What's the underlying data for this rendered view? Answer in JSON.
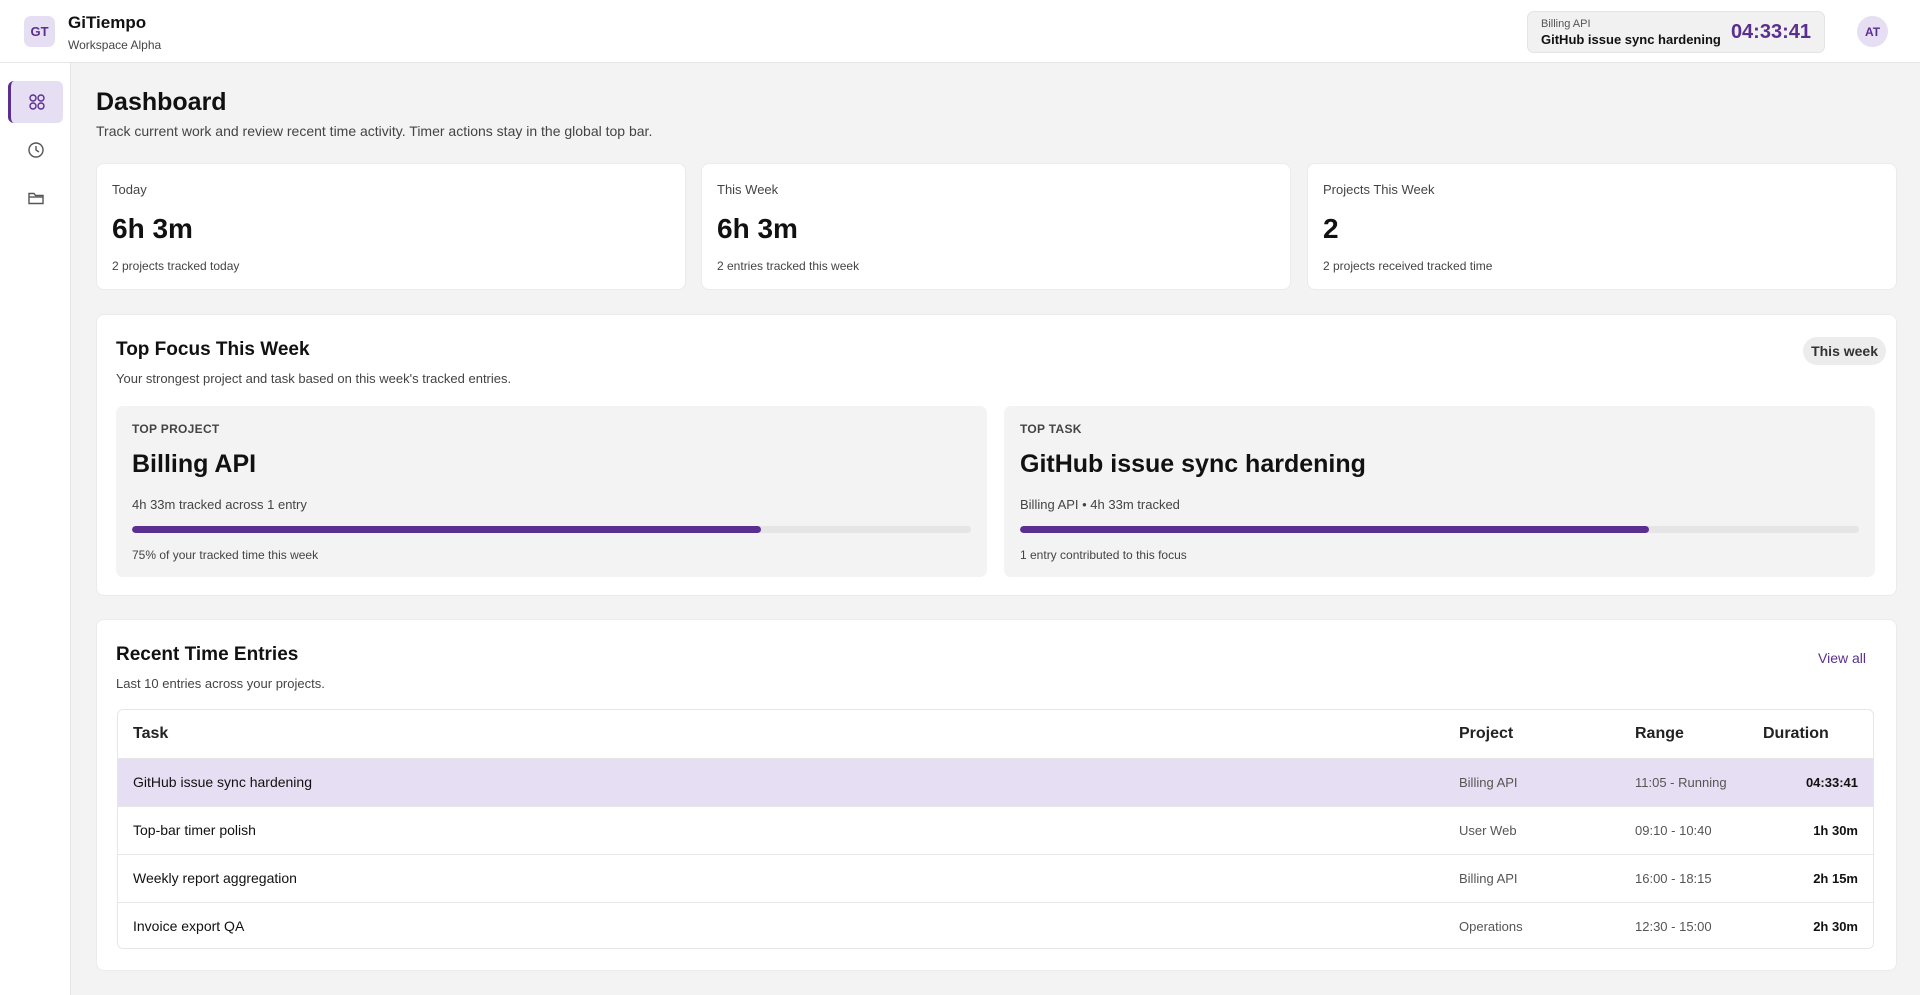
{
  "app": {
    "logo_initials": "GT",
    "name": "GiTiempo",
    "workspace": "Workspace Alpha"
  },
  "timer": {
    "project": "Billing API",
    "task": "GitHub issue sync hardening",
    "elapsed": "04:33:41"
  },
  "user": {
    "initials": "AT"
  },
  "sidebar": {
    "items": [
      {
        "icon": "dashboard-icon",
        "active": true
      },
      {
        "icon": "clock-icon",
        "active": false
      },
      {
        "icon": "folder-icon",
        "active": false
      }
    ]
  },
  "page": {
    "title": "Dashboard",
    "subtitle": "Track current work and review recent time activity. Timer actions stay in the global top bar."
  },
  "stats": [
    {
      "label": "Today",
      "value": "6h 3m",
      "sub": "2 projects tracked today"
    },
    {
      "label": "This Week",
      "value": "6h 3m",
      "sub": "2 entries tracked this week"
    },
    {
      "label": "Projects This Week",
      "value": "2",
      "sub": "2 projects received tracked time"
    }
  ],
  "focus": {
    "title": "Top Focus This Week",
    "subtitle": "Your strongest project and task based on this week's tracked entries.",
    "period": "This week",
    "project": {
      "kicker": "TOP PROJECT",
      "name": "Billing API",
      "meta": "4h 33m tracked across 1 entry",
      "progress": 0.75,
      "foot": "75% of your tracked time this week"
    },
    "task": {
      "kicker": "TOP TASK",
      "name": "GitHub issue sync hardening",
      "meta": "Billing API • 4h 33m tracked",
      "progress": 0.75,
      "foot": "1 entry contributed to this focus"
    }
  },
  "recent": {
    "title": "Recent Time Entries",
    "subtitle": "Last 10 entries across your projects.",
    "view_all": "View all",
    "columns": {
      "task": "Task",
      "project": "Project",
      "range": "Range",
      "duration": "Duration"
    },
    "rows": [
      {
        "task": "GitHub issue sync hardening",
        "project": "Billing API",
        "range": "11:05 - Running",
        "duration": "04:33:41",
        "running": true
      },
      {
        "task": "Top-bar timer polish",
        "project": "User Web",
        "range": "09:10 - 10:40",
        "duration": "1h 30m",
        "running": false
      },
      {
        "task": "Weekly report aggregation",
        "project": "Billing API",
        "range": "16:00 - 18:15",
        "duration": "2h 15m",
        "running": false
      },
      {
        "task": "Invoice export QA",
        "project": "Operations",
        "range": "12:30 - 15:00",
        "duration": "2h 30m",
        "running": false
      }
    ]
  },
  "colors": {
    "accent": "#5b2f8f",
    "accent_soft": "#e6def2"
  }
}
